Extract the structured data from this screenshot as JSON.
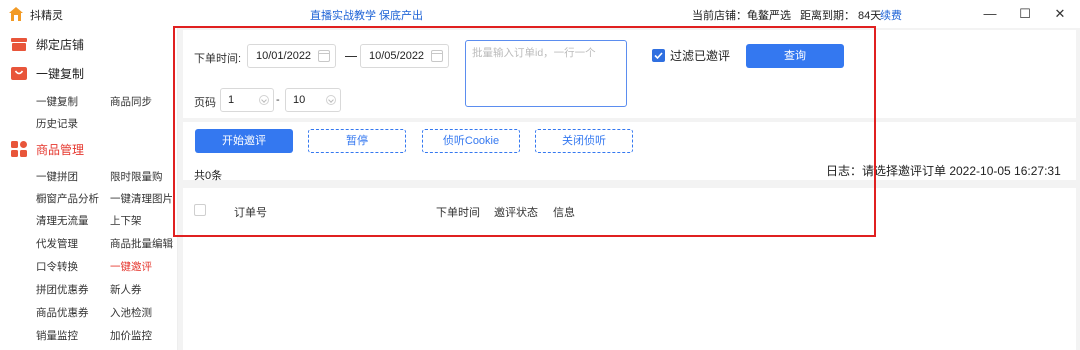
{
  "titlebar": {
    "app_title": "抖精灵",
    "promo": "直播实战教学 保底产出",
    "store_label": "当前店铺：龟鳌严选",
    "expire_label": "距离到期： 84天",
    "renew": "续费",
    "minimize": "—",
    "maximize": "☐",
    "close": "✕"
  },
  "sidebar": {
    "bind_store": "绑定店铺",
    "copy_header": "一键复制",
    "copy_items": [
      "一键复制",
      "商品同步",
      "历史记录"
    ],
    "goods_header": "商品管理",
    "goods_items": [
      "一键拼团",
      "限时限量购",
      "橱窗产品分析",
      "一键清理图片",
      "清理无流量",
      "上下架",
      "代发管理",
      "商品批量编辑",
      "口令转换",
      "一键邀评",
      "拼团优惠券",
      "新人券",
      "商品优惠券",
      "入池检测",
      "销量监控",
      "加价监控"
    ],
    "active_item": "一键邀评"
  },
  "filters": {
    "order_time_label": "下单时间:",
    "date_from": "10/01/2022",
    "date_to": "10/05/2022",
    "order_id_placeholder": "批量输入订单id，一行一个",
    "filter_reviewed_label": "过滤已邀评",
    "filter_reviewed_checked": true,
    "query_button": "查询",
    "page_label": "页码",
    "page_value": "1",
    "page_size_sep": "-",
    "page_size": "10"
  },
  "actions": {
    "start": "开始邀评",
    "pause": "暂停",
    "listen_cookie": "侦听Cookie",
    "close_listen": "关闭侦听"
  },
  "status": {
    "count": "共0条",
    "log": "日志：请选择邀评订单 2022-10-05 16:27:31"
  },
  "table": {
    "columns": [
      "订单号",
      "下单时间",
      "邀评状态",
      "信息"
    ]
  },
  "colors": {
    "accent": "#3478f0",
    "active_red": "#e5372e",
    "highlight_frame": "#e02020"
  }
}
